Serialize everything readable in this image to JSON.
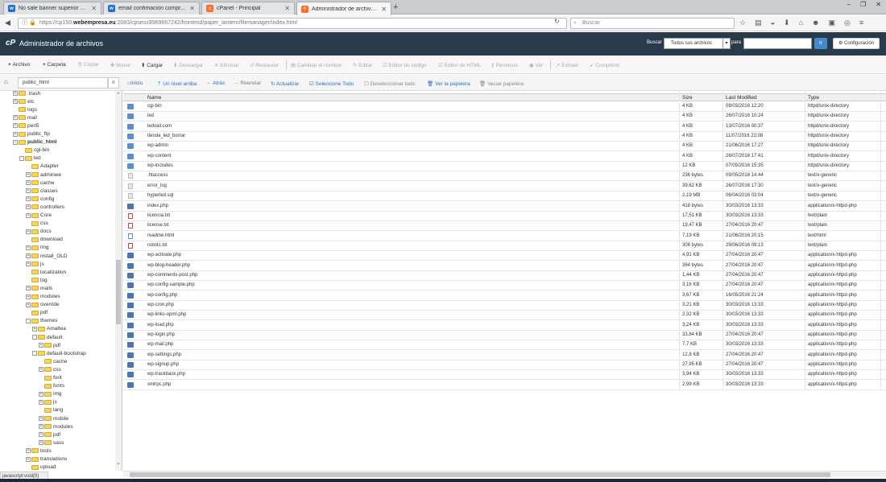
{
  "browser": {
    "tabs": [
      {
        "label": "No sale banner superior A...",
        "icon": "w-icon",
        "color": "#1e6fd1"
      },
      {
        "label": "email confimacion compr...",
        "icon": "w-icon",
        "color": "#1e6fd1"
      },
      {
        "label": "cPanel - Principal",
        "icon": "cpanel-icon",
        "color": "#ff6c2c"
      },
      {
        "label": "Administrador de archivos...",
        "icon": "cpanel-icon",
        "color": "#ff6c2c"
      }
    ],
    "url_prefix": "https://cp150.",
    "url_domain": "webempresa.eu",
    "url_rest": ":2083/cpsess9969667242/frontend/paper_lantern/filemanager/index.html",
    "search_placeholder": "Buscar"
  },
  "header": {
    "title": "Administrador de archivos",
    "search_label": "Buscar",
    "search_scope": "Todos sus archivos",
    "para_label": "para",
    "go_label": "Ir",
    "settings_label": "Configuración",
    "logo_text": "cP"
  },
  "toolbar": {
    "archivo": "Archivo",
    "carpeta": "Carpeta",
    "copiar": "Copiar",
    "mover": "Mover",
    "cargar": "Cargar",
    "descargar": "Descargar",
    "eliminar": "Eliminar",
    "restaurar": "Restaurar",
    "cambiar_nombre": "Cambiar el nombre",
    "editar": "Editar",
    "editor_codigo": "Editor de código",
    "editor_html": "Editor de HTML",
    "permisos": "Permisos",
    "ver": "Ver",
    "extraer": "Extraer",
    "comprimir": "Comprimir"
  },
  "pathbar": {
    "path": "public_html",
    "go": "Ir",
    "inicio": "Inicio",
    "nivel_arriba": "Un nivel arriba",
    "atras": "Atrás",
    "reenviar": "Reenviar",
    "actualizar": "Actualizar",
    "seleccione_todo": "Seleccione Todo",
    "deseleccionar_todo": "Deseleccionar todo",
    "ver_papelera": "Ver la papelera",
    "vaciar_papelera": "Vaciar papelera"
  },
  "tree": [
    {
      "label": ".trash",
      "level": 1,
      "pm": "+"
    },
    {
      "label": "etc",
      "level": 1,
      "pm": "+"
    },
    {
      "label": "logs",
      "level": 1,
      "pm": ""
    },
    {
      "label": "mail",
      "level": 1,
      "pm": "+"
    },
    {
      "label": "perl5",
      "level": 1,
      "pm": "+"
    },
    {
      "label": "public_ftp",
      "level": 1,
      "pm": "+"
    },
    {
      "label": "public_html",
      "level": 1,
      "pm": "-",
      "bold": true
    },
    {
      "label": "cgi-bin",
      "level": 2,
      "pm": ""
    },
    {
      "label": "led",
      "level": 2,
      "pm": "-"
    },
    {
      "label": "Adapter",
      "level": 3,
      "pm": ""
    },
    {
      "label": "adminwe",
      "level": 3,
      "pm": "+"
    },
    {
      "label": "cache",
      "level": 3,
      "pm": "+"
    },
    {
      "label": "classes",
      "level": 3,
      "pm": "+"
    },
    {
      "label": "config",
      "level": 3,
      "pm": "+"
    },
    {
      "label": "controllers",
      "level": 3,
      "pm": "+"
    },
    {
      "label": "Core",
      "level": 3,
      "pm": "+"
    },
    {
      "label": "css",
      "level": 3,
      "pm": ""
    },
    {
      "label": "docs",
      "level": 3,
      "pm": "+"
    },
    {
      "label": "download",
      "level": 3,
      "pm": ""
    },
    {
      "label": "img",
      "level": 3,
      "pm": "+"
    },
    {
      "label": "install_OLD",
      "level": 3,
      "pm": "+"
    },
    {
      "label": "js",
      "level": 3,
      "pm": "+"
    },
    {
      "label": "localization",
      "level": 3,
      "pm": ""
    },
    {
      "label": "log",
      "level": 3,
      "pm": ""
    },
    {
      "label": "mails",
      "level": 3,
      "pm": "+"
    },
    {
      "label": "modules",
      "level": 3,
      "pm": "+"
    },
    {
      "label": "override",
      "level": 3,
      "pm": "+"
    },
    {
      "label": "pdf",
      "level": 3,
      "pm": ""
    },
    {
      "label": "themes",
      "level": 3,
      "pm": "-"
    },
    {
      "label": "Amaltea",
      "level": 4,
      "pm": "+"
    },
    {
      "label": "default",
      "level": 4,
      "pm": "-"
    },
    {
      "label": "pdf",
      "level": 5,
      "pm": "+"
    },
    {
      "label": "default-bootstrap",
      "level": 4,
      "pm": "-"
    },
    {
      "label": "cache",
      "level": 5,
      "pm": ""
    },
    {
      "label": "css",
      "level": 5,
      "pm": "+"
    },
    {
      "label": "font",
      "level": 5,
      "pm": ""
    },
    {
      "label": "fonts",
      "level": 5,
      "pm": ""
    },
    {
      "label": "img",
      "level": 5,
      "pm": "+"
    },
    {
      "label": "js",
      "level": 5,
      "pm": "+"
    },
    {
      "label": "lang",
      "level": 5,
      "pm": ""
    },
    {
      "label": "mobile",
      "level": 5,
      "pm": "+"
    },
    {
      "label": "modules",
      "level": 5,
      "pm": "+"
    },
    {
      "label": "pdf",
      "level": 5,
      "pm": "+"
    },
    {
      "label": "sass",
      "level": 5,
      "pm": "+"
    },
    {
      "label": "tools",
      "level": 3,
      "pm": "+"
    },
    {
      "label": "translations",
      "level": 3,
      "pm": "+"
    },
    {
      "label": "upload",
      "level": 3,
      "pm": ""
    }
  ],
  "columns": {
    "name": "Name",
    "size": "Size",
    "modified": "Last Modified",
    "type": "Type"
  },
  "files": [
    {
      "name": "cgi-bin",
      "size": "4 KB",
      "modified": "08/03/2016 12:20",
      "type": "httpd/unix-directory",
      "icon": "dir"
    },
    {
      "name": "led",
      "size": "4 KB",
      "modified": "26/07/2016 10:24",
      "type": "httpd/unix-directory",
      "icon": "dir"
    },
    {
      "name": "ledvail.com",
      "size": "4 KB",
      "modified": "13/07/2016 00:37",
      "type": "httpd/unix-directory",
      "icon": "dir"
    },
    {
      "name": "tienda_led_borrar",
      "size": "4 KB",
      "modified": "11/07/2016 22:08",
      "type": "httpd/unix-directory",
      "icon": "dir"
    },
    {
      "name": "wp-admin",
      "size": "4 KB",
      "modified": "21/06/2016 17:27",
      "type": "httpd/unix-directory",
      "icon": "dir"
    },
    {
      "name": "wp-content",
      "size": "4 KB",
      "modified": "26/07/2016 17:41",
      "type": "httpd/unix-directory",
      "icon": "dir"
    },
    {
      "name": "wp-includes",
      "size": "12 KB",
      "modified": "07/05/2016 15:35",
      "type": "httpd/unix-directory",
      "icon": "dir"
    },
    {
      "name": ".htaccess",
      "size": "236 bytes",
      "modified": "09/05/2016 14:44",
      "type": "text/x-generic",
      "icon": "file"
    },
    {
      "name": "error_log",
      "size": "39,62 KB",
      "modified": "26/07/2016 17:30",
      "type": "text/x-generic",
      "icon": "file"
    },
    {
      "name": "hyperled.sql",
      "size": "2,19 MB",
      "modified": "06/04/2016 03:04",
      "type": "text/x-generic",
      "icon": "file"
    },
    {
      "name": "index.php",
      "size": "418 bytes",
      "modified": "30/03/2016 13:33",
      "type": "application/x-httpd-php",
      "icon": "php"
    },
    {
      "name": "licencia.txt",
      "size": "17,51 KB",
      "modified": "30/03/2016 13:33",
      "type": "text/plain",
      "icon": "txt"
    },
    {
      "name": "license.txt",
      "size": "19,47 KB",
      "modified": "27/04/2016 20:47",
      "type": "text/plain",
      "icon": "txt"
    },
    {
      "name": "readme.html",
      "size": "7,19 KB",
      "modified": "21/06/2016 20:15",
      "type": "text/html",
      "icon": "html"
    },
    {
      "name": "robots.txt",
      "size": "308 bytes",
      "modified": "29/06/2016 09:13",
      "type": "text/plain",
      "icon": "txt"
    },
    {
      "name": "wp-activate.php",
      "size": "4,91 KB",
      "modified": "27/04/2016 20:47",
      "type": "application/x-httpd-php",
      "icon": "php"
    },
    {
      "name": "wp-blog-header.php",
      "size": "364 bytes",
      "modified": "27/04/2016 20:47",
      "type": "application/x-httpd-php",
      "icon": "php"
    },
    {
      "name": "wp-comments-post.php",
      "size": "1,44 KB",
      "modified": "27/04/2016 20:47",
      "type": "application/x-httpd-php",
      "icon": "php"
    },
    {
      "name": "wp-config-sample.php",
      "size": "3,16 KB",
      "modified": "27/04/2016 20:47",
      "type": "application/x-httpd-php",
      "icon": "php"
    },
    {
      "name": "wp-config.php",
      "size": "3,67 KB",
      "modified": "16/05/2016 21:24",
      "type": "application/x-httpd-php",
      "icon": "php"
    },
    {
      "name": "wp-cron.php",
      "size": "3,21 KB",
      "modified": "30/03/2016 13:33",
      "type": "application/x-httpd-php",
      "icon": "php"
    },
    {
      "name": "wp-links-opml.php",
      "size": "2,32 KB",
      "modified": "30/03/2016 13:33",
      "type": "application/x-httpd-php",
      "icon": "php"
    },
    {
      "name": "wp-load.php",
      "size": "3,24 KB",
      "modified": "30/03/2016 13:33",
      "type": "application/x-httpd-php",
      "icon": "php"
    },
    {
      "name": "wp-login.php",
      "size": "33,84 KB",
      "modified": "27/04/2016 20:47",
      "type": "application/x-httpd-php",
      "icon": "php"
    },
    {
      "name": "wp-mail.php",
      "size": "7,7 KB",
      "modified": "30/03/2016 13:33",
      "type": "application/x-httpd-php",
      "icon": "php"
    },
    {
      "name": "wp-settings.php",
      "size": "12,8 KB",
      "modified": "27/04/2016 20:47",
      "type": "application/x-httpd-php",
      "icon": "php"
    },
    {
      "name": "wp-signup.php",
      "size": "27,95 KB",
      "modified": "27/04/2016 20:47",
      "type": "application/x-httpd-php",
      "icon": "php"
    },
    {
      "name": "wp-trackback.php",
      "size": "3,94 KB",
      "modified": "30/03/2016 13:33",
      "type": "application/x-httpd-php",
      "icon": "php"
    },
    {
      "name": "xmlrpc.php",
      "size": "2,99 KB",
      "modified": "30/03/2016 13:33",
      "type": "application/x-httpd-php",
      "icon": "php"
    }
  ],
  "status": "javascript:void(0)"
}
